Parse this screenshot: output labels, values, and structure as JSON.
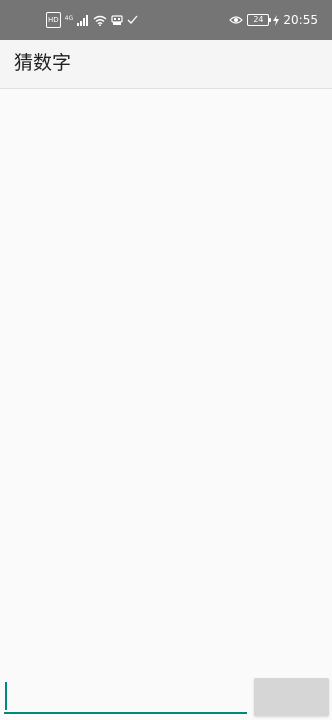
{
  "status_bar": {
    "hd_badge": "HD",
    "network_type": "4G",
    "battery_level": "24",
    "time": "20:55",
    "icons": [
      "hd-icon",
      "signal-icon",
      "wifi-icon",
      "usb-icon",
      "check-icon",
      "eye-comfort-icon",
      "battery-icon",
      "charging-icon"
    ]
  },
  "app_bar": {
    "title": "猜数字"
  },
  "content": {
    "messages": []
  },
  "input_bar": {
    "value": "",
    "placeholder": "",
    "submit_label": ""
  },
  "colors": {
    "status_bar_bg": "#757575",
    "app_bar_bg": "#f5f5f5",
    "page_bg": "#fafafa",
    "accent": "#00897b",
    "button_bg": "#d6d6d6"
  }
}
